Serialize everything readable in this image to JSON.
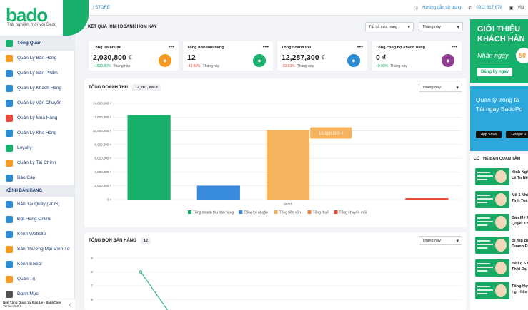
{
  "brand": {
    "logo": "bado",
    "tagline": "Trải nghiệm mới với Bado",
    "accent": "#18b06b"
  },
  "sidebar": {
    "items": [
      {
        "label": "Tổng Quan",
        "icon": "dashboard-icon",
        "color": "#18b06b",
        "active": true
      },
      {
        "label": "Quản Lý Bán Hàng",
        "icon": "sales-icon",
        "color": "#f59a23"
      },
      {
        "label": "Quản Lý Sản Phẩm",
        "icon": "product-icon",
        "color": "#2c8cd1"
      },
      {
        "label": "Quản Lý Khách Hàng",
        "icon": "customer-icon",
        "color": "#2c8cd1"
      },
      {
        "label": "Quản Lý Vận Chuyển",
        "icon": "truck-icon",
        "color": "#2c8cd1"
      },
      {
        "label": "Quản Lý Mua Hàng",
        "icon": "cart-icon",
        "color": "#e94b3c"
      },
      {
        "label": "Quản Lý Kho Hàng",
        "icon": "warehouse-icon",
        "color": "#2c8cd1"
      },
      {
        "label": "Loyalty",
        "icon": "loyalty-icon",
        "color": "#18b06b"
      },
      {
        "label": "Quản Lý Tài Chính",
        "icon": "finance-icon",
        "color": "#f59a23"
      },
      {
        "label": "Báo Cáo",
        "icon": "report-icon",
        "color": "#2c8cd1"
      }
    ],
    "section": "KÊNH BÁN HÀNG",
    "channels": [
      {
        "label": "Bán Tại Quầy (POS)",
        "icon": "pos-icon",
        "color": "#2c8cd1"
      },
      {
        "label": "Đặt Hàng Online",
        "icon": "online-order-icon",
        "color": "#2c8cd1"
      },
      {
        "label": "Kênh Website",
        "icon": "website-icon",
        "color": "#2c8cd1"
      },
      {
        "label": "Sàn Thương Mại Điện Tử",
        "icon": "marketplace-icon",
        "color": "#f59a23"
      },
      {
        "label": "Kênh Social",
        "icon": "social-icon",
        "color": "#2c8cd1"
      },
      {
        "label": "Quản Trị",
        "icon": "admin-icon",
        "color": "#f59a23"
      },
      {
        "label": "Danh Mục",
        "icon": "category-icon",
        "color": "#555555"
      }
    ],
    "footer_line1": "Nền Tảng Quản Lý Bán Lẻ - BadoCore",
    "footer_line2": "Version 5.0.1"
  },
  "topbar": {
    "breadcrumb": "/ STORE",
    "help": "Hướng dẫn sử dụng",
    "phone": "0911 617 678",
    "extra": "Vid"
  },
  "today": {
    "title": "KẾT QUẢ KINH DOANH HÔM NAY",
    "store_filter": "Tất cả cửa hàng",
    "period": "Tháng này",
    "kpis": [
      {
        "title": "Tổng lợi nhuận",
        "value": "2,030,800 ₫",
        "change": "+1500.80%",
        "change_color": "#18b06b",
        "period": "Tháng này",
        "icon_color": "#f59a23",
        "icon": "money-bag-icon"
      },
      {
        "title": "Tổng đơn bán hàng",
        "value": "12",
        "change": "-42.86%",
        "change_color": "#e94b3c",
        "period": "Tháng này",
        "icon_color": "#18b06b",
        "icon": "clock-icon"
      },
      {
        "title": "Tổng doanh thu",
        "value": "12,287,300 ₫",
        "change": "-20.63%",
        "change_color": "#e94b3c",
        "period": "Tháng này",
        "icon_color": "#2c8cd1",
        "icon": "bar-chart-icon"
      },
      {
        "title": "Tổng công nợ khách hàng",
        "value": "0 ₫",
        "change": "+0.00%",
        "change_color": "#18b06b",
        "period": "Tháng này",
        "icon_color": "#8e3b8f",
        "icon": "customer-debt-icon"
      }
    ]
  },
  "revenue": {
    "title": "TỔNG DOANH THU",
    "total": "12,287,300 ₫",
    "period": "Tháng này"
  },
  "orders": {
    "title": "TỔNG ĐƠN BÁN HÀNG",
    "count": "12",
    "period": "Tháng này"
  },
  "chart_data": [
    {
      "type": "bar",
      "categories": [
        "06/03"
      ],
      "series": [
        {
          "name": "Tổng doanh thu bán hàng",
          "values": [
            12287300
          ],
          "color": "#18b06b"
        },
        {
          "name": "Tổng lợi nhuận",
          "values": [
            2030800
          ],
          "color": "#3a8dde"
        },
        {
          "name": "Tổng tiền vốn",
          "values": [
            10110200
          ],
          "color": "#f6b35e"
        },
        {
          "name": "Tổng thuế",
          "values": [
            0
          ],
          "color": "#f28b43"
        },
        {
          "name": "Tổng khuyến mãi",
          "values": [
            150000
          ],
          "color": "#e94b3c"
        }
      ],
      "ylim": [
        0,
        14000000
      ],
      "yticks": [
        "0 ₫",
        "2,000,000 ₫",
        "4,000,000 ₫",
        "6,000,000 ₫",
        "8,000,000 ₫",
        "10,000,000 ₫",
        "12,000,000 ₫",
        "14,000,000 ₫"
      ],
      "tooltip": "10,110,200 ₫",
      "grid": true,
      "legend": "bottom"
    },
    {
      "type": "line",
      "yticks": [
        "6",
        "7",
        "8",
        "9"
      ],
      "ylim": [
        5,
        9
      ],
      "x": [
        0,
        1
      ],
      "values": [
        8,
        5
      ],
      "color": "#18b06b",
      "grid": true
    }
  ],
  "promo": {
    "line1": "GIỚI THIỆU",
    "line2": "KHÁCH HÀN",
    "line3": "Nhận ngay",
    "badge": "50",
    "button": "Đăng ký ngay"
  },
  "promo2": {
    "line1": "Quản lý trong tầ",
    "line2": "Tải ngay BadoPo",
    "app_store": "App Store",
    "google_play": "Google P"
  },
  "interest": {
    "title": "CÓ THỂ BẠN QUAN TÂM",
    "articles": [
      {
        "l1": "Kinh Ngh",
        "l2": "Lẻ To Nê"
      },
      {
        "l1": "Mô 1 Nhà",
        "l2": "Tinh Toá"
      },
      {
        "l1": "Bán Mỹ P",
        "l2": "Quyết Th"
      },
      {
        "l1": "Bí Kíp Bá",
        "l2": "Doanh Đi"
      },
      {
        "l1": "Hé Lộ 5 M",
        "l2": "Thời Đại"
      },
      {
        "l1": "Tổng Hợ",
        "l2": "t gì Hiệu"
      }
    ]
  }
}
